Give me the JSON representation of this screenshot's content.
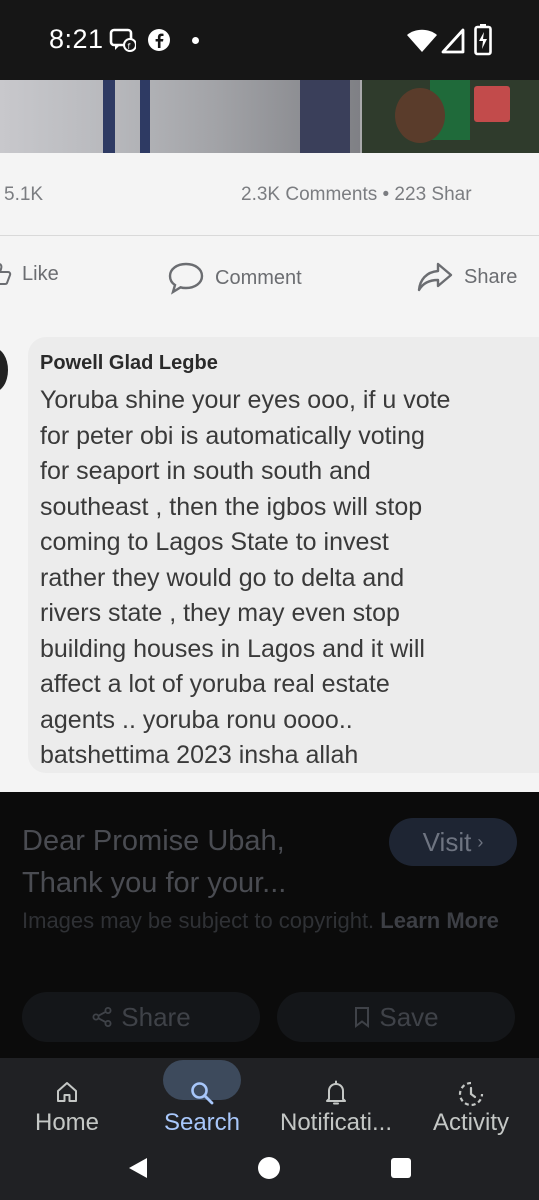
{
  "status_bar": {
    "time": "8:21",
    "icons": [
      "chat-bubble-icon",
      "facebook-icon",
      "notification-dot",
      "wifi-icon",
      "cellular-icon",
      "battery-charging-icon"
    ]
  },
  "post": {
    "likes_count": "5.1K",
    "comments_shares": "2.3K Comments • 223 Shar",
    "actions": {
      "like": "Like",
      "comment": "Comment",
      "share": "Share"
    },
    "comment": {
      "author": "Powell Glad Legbe",
      "text": "Yoruba shine your eyes ooo, if u vote\nfor peter obi is automatically voting\nfor seaport in south south and\nsoutheast , then the igbos will stop\ncoming to Lagos  State to invest\nrather they would go to delta and\nrivers state , they may even stop\nbuilding houses in Lagos and it will\naffect a lot of yoruba real estate\nagents .. yoruba ronu oooo..\nbatshettima 2023 insha allah"
    }
  },
  "result": {
    "title": "Dear Promise Ubah, Thank you for your...",
    "visit_label": "Visit",
    "copyright_text": "Images may be subject to copyright.",
    "learn_more": "Learn More",
    "share_label": "Share",
    "save_label": "Save"
  },
  "bottom_nav": {
    "items": [
      {
        "label": "Home",
        "icon": "home-icon"
      },
      {
        "label": "Search",
        "icon": "search-icon",
        "active": true
      },
      {
        "label": "Notificati...",
        "icon": "bell-icon"
      },
      {
        "label": "Activity",
        "icon": "activity-icon"
      }
    ]
  },
  "colors": {
    "accent": "#a8c7fa",
    "nav_bg": "#202124",
    "active_pill": "#3d4a5c"
  }
}
